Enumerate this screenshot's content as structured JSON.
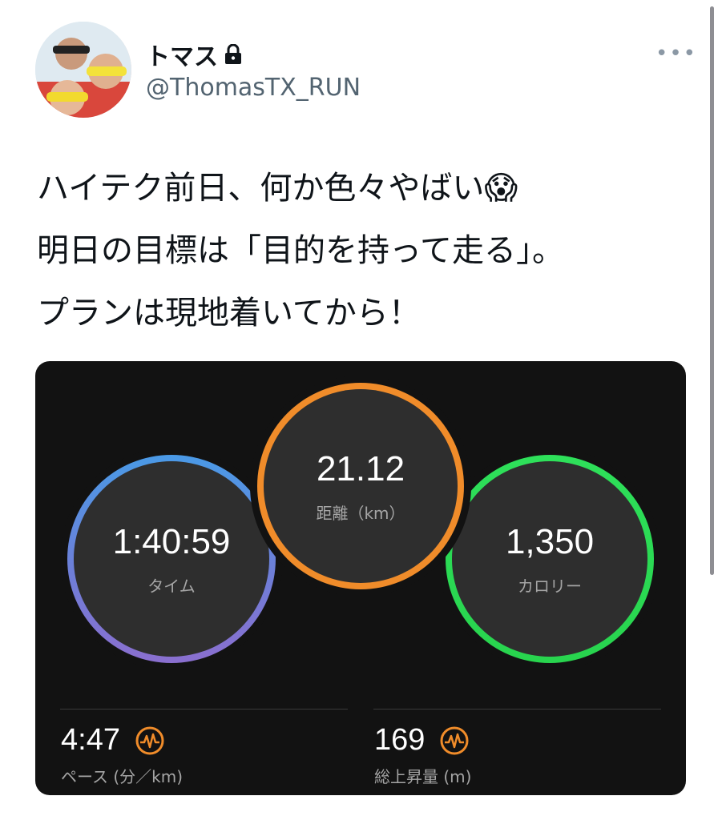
{
  "user": {
    "display_name": "トマス",
    "handle": "@ThomasTX_RUN",
    "protected_icon": "lock-icon",
    "more_icon": "more-dots-icon"
  },
  "tweet": {
    "text": "ハイテク前日、何か色々やばい😱\n明日の目標は「目的を持って走る」。\nプランは現地着いてから！"
  },
  "activity": {
    "distance": {
      "value": "21.12",
      "label": "距離（km）",
      "color": "#f08c2a"
    },
    "time": {
      "value": "1:40:59",
      "label": "タイム",
      "color": "#4a9ae6"
    },
    "calories": {
      "value": "1,350",
      "label": "カロリー",
      "color": "#2ee05a"
    },
    "pace": {
      "value": "4:47",
      "label": "ペース (分／km)",
      "icon": "pulse-icon"
    },
    "elevation": {
      "value": "169",
      "label": "総上昇量 (m)",
      "icon": "pulse-icon"
    },
    "accent_color": "#f08c2a"
  }
}
